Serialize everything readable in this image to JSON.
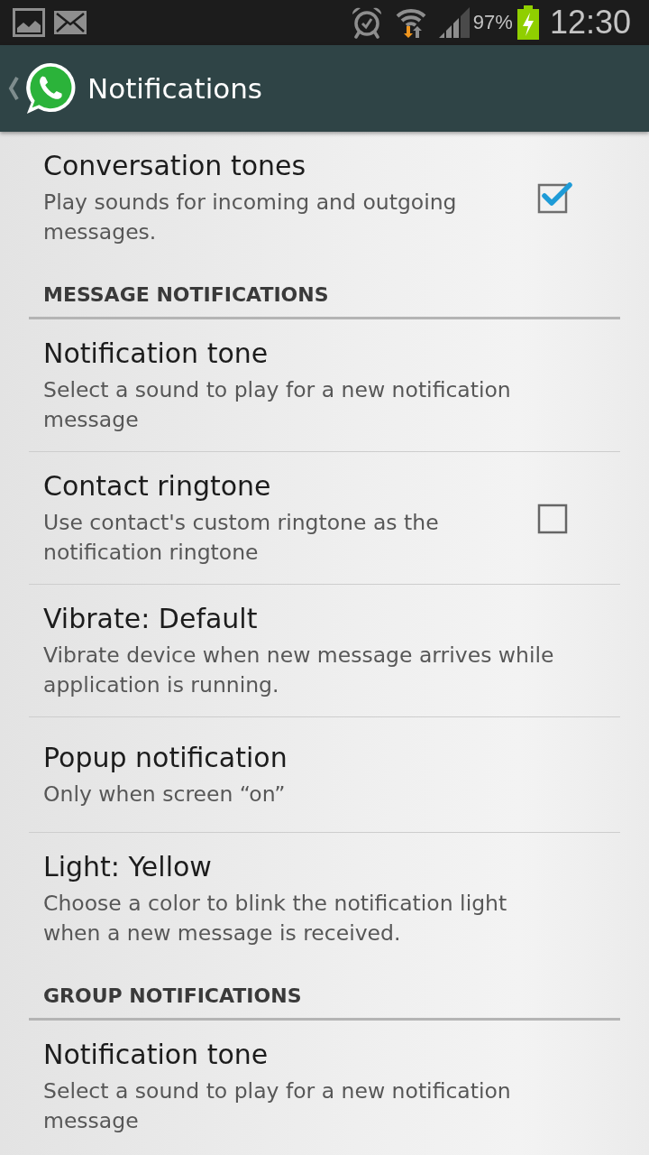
{
  "status_bar": {
    "battery": "97%",
    "time": "12:30"
  },
  "action_bar": {
    "title": "Notifications"
  },
  "general": [
    {
      "kind": "checkbox",
      "title": "Conversation tones",
      "summary": "Play sounds for incoming and outgoing messages.",
      "checked": true
    }
  ],
  "sections": [
    {
      "header": "MESSAGE NOTIFICATIONS",
      "items": [
        {
          "kind": "plain",
          "title": "Notification tone",
          "summary": "Select a sound to play for a new notification message"
        },
        {
          "kind": "checkbox",
          "title": "Contact ringtone",
          "summary": "Use contact's custom ringtone as the notification ringtone",
          "checked": false
        },
        {
          "kind": "plain",
          "title": "Vibrate: Default",
          "summary": "Vibrate device when new message arrives while application is running."
        },
        {
          "kind": "plain",
          "title": "Popup notification",
          "summary": "Only when screen “on”"
        },
        {
          "kind": "plain",
          "title": "Light: Yellow",
          "summary": "Choose a color to blink the notification light when a new message is received."
        }
      ]
    },
    {
      "header": "GROUP NOTIFICATIONS",
      "items": [
        {
          "kind": "plain",
          "title": "Notification tone",
          "summary": "Select a sound to play for a new notification message"
        }
      ]
    }
  ]
}
